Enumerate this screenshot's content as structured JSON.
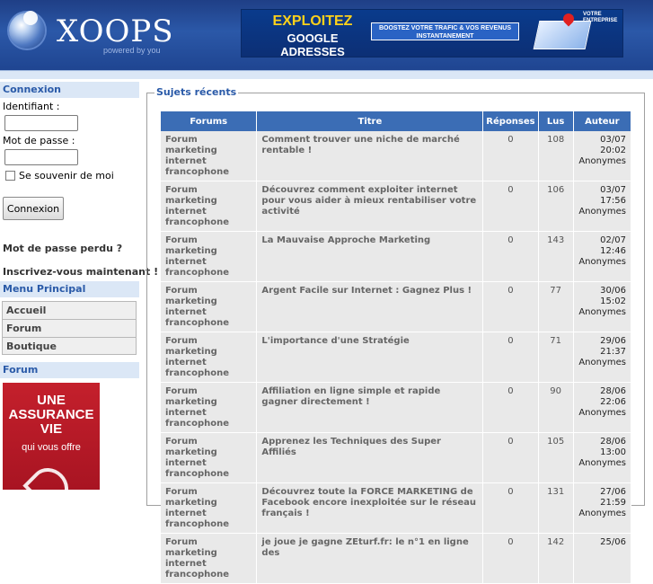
{
  "header": {
    "logo_text": "XOOPS",
    "logo_sub": "powered by you",
    "banner": {
      "line1": "EXPLOITEZ",
      "line2": "GOOGLE ADRESSES",
      "middle": "BOOSTEZ VOTRE TRAFIC & VOS REVENUS INSTANTANEMENT",
      "tag": "VOTRE ENTREPRISE"
    }
  },
  "sidebar": {
    "login_title": "Connexion",
    "username_label": "Identifiant :",
    "password_label": "Mot de passe :",
    "remember_label": "Se souvenir de moi",
    "login_button": "Connexion",
    "lost_password": "Mot de passe perdu ?",
    "register": "Inscrivez-vous maintenant !",
    "menu_title": "Menu Principal",
    "menu_items": [
      "Accueil",
      "Forum",
      "Boutique"
    ],
    "forum_title": "Forum",
    "ad": {
      "line1": "UNE ASSURANCE VIE",
      "line2": "qui vous offre"
    }
  },
  "main": {
    "legend": "Sujets récents",
    "columns": [
      "Forums",
      "Titre",
      "Réponses",
      "Lus",
      "Auteur"
    ],
    "rows": [
      {
        "forum": "Forum marketing internet francophone",
        "title": "Comment trouver une niche de marché rentable !",
        "replies": "0",
        "reads": "108",
        "date": "03/07",
        "time": "20:02",
        "author": "Anonymes"
      },
      {
        "forum": "Forum marketing internet francophone",
        "title": "Découvrez comment exploiter internet pour vous aider à mieux rentabiliser votre activité",
        "replies": "0",
        "reads": "106",
        "date": "03/07",
        "time": "17:56",
        "author": "Anonymes"
      },
      {
        "forum": "Forum marketing internet francophone",
        "title": "La Mauvaise Approche Marketing",
        "replies": "0",
        "reads": "143",
        "date": "02/07",
        "time": "12:46",
        "author": "Anonymes"
      },
      {
        "forum": "Forum marketing internet francophone",
        "title": "Argent Facile sur Internet : Gagnez Plus !",
        "replies": "0",
        "reads": "77",
        "date": "30/06",
        "time": "15:02",
        "author": "Anonymes"
      },
      {
        "forum": "Forum marketing internet francophone",
        "title": "L'importance d'une Stratégie",
        "replies": "0",
        "reads": "71",
        "date": "29/06",
        "time": "21:37",
        "author": "Anonymes"
      },
      {
        "forum": "Forum marketing internet francophone",
        "title": "Affiliation en ligne simple et rapide gagner directement !",
        "replies": "0",
        "reads": "90",
        "date": "28/06",
        "time": "22:06",
        "author": "Anonymes"
      },
      {
        "forum": "Forum marketing internet francophone",
        "title": "Apprenez les Techniques des Super Affiliés",
        "replies": "0",
        "reads": "105",
        "date": "28/06",
        "time": "13:00",
        "author": "Anonymes"
      },
      {
        "forum": "Forum marketing internet francophone",
        "title": "Découvrez toute la FORCE MARKETING de Facebook encore inexploitée sur le réseau français !",
        "replies": "0",
        "reads": "131",
        "date": "27/06",
        "time": "21:59",
        "author": "Anonymes"
      },
      {
        "forum": "Forum marketing internet francophone",
        "title": "je joue je gagne ZEturf.fr: le n°1 en ligne des",
        "replies": "0",
        "reads": "142",
        "date": "25/06",
        "time": "",
        "author": ""
      }
    ]
  }
}
